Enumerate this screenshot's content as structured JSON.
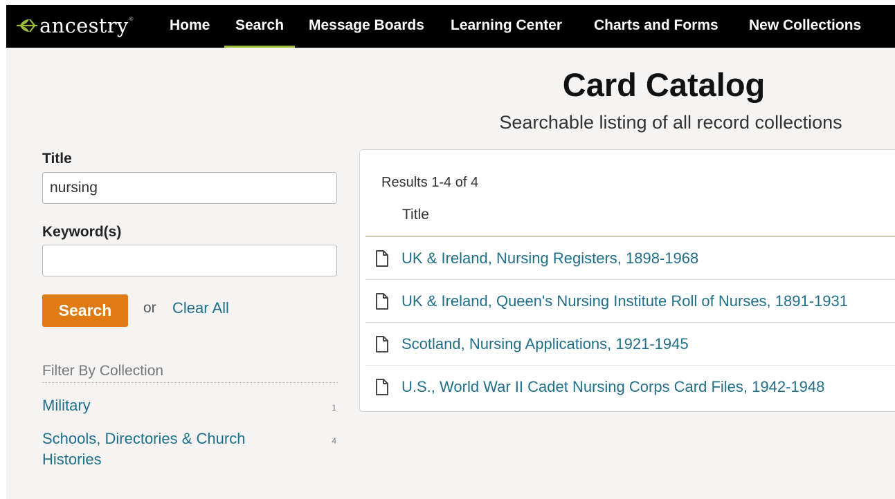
{
  "nav": {
    "logo": "ancestry",
    "logo_tm": "®",
    "items": [
      "Home",
      "Search",
      "Message Boards",
      "Learning Center",
      "Charts and Forms",
      "New Collections"
    ],
    "active": "Search"
  },
  "header": {
    "title": "Card Catalog",
    "subtitle": "Searchable listing of all record collections"
  },
  "search": {
    "title_label": "Title",
    "title_value": "nursing",
    "keyword_label": "Keyword(s)",
    "keyword_value": "",
    "search_button": "Search",
    "or_text": "or",
    "clear_all": "Clear All"
  },
  "filter": {
    "heading": "Filter By Collection",
    "items": [
      {
        "label": "Military",
        "count": "1"
      },
      {
        "label": "Schools, Directories & Church Histories",
        "count": "4"
      }
    ]
  },
  "results": {
    "count_text": "Results 1-4 of 4",
    "column_header": "Title",
    "rows": [
      "UK & Ireland, Nursing Registers, 1898-1968",
      "UK & Ireland, Queen's Nursing Institute Roll of Nurses, 1891-1931",
      "Scotland, Nursing Applications, 1921-1945",
      "U.S., World War II Cadet Nursing Corps Card Files, 1942-1948"
    ]
  },
  "colors": {
    "nav_bg": "#000000",
    "active_underline": "#9cbe3b",
    "search_button": "#e07a12",
    "link": "#1f6f8b",
    "background": "#f5f4f2"
  }
}
